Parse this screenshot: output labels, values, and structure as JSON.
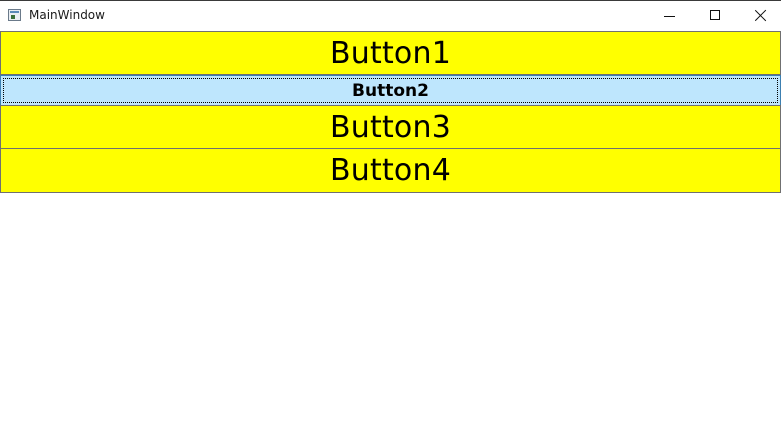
{
  "window": {
    "title": "MainWindow",
    "icon": "app-window-icon",
    "controls": {
      "minimize": "minimize-icon",
      "maximize": "maximize-icon",
      "close": "close-icon"
    }
  },
  "buttons": [
    {
      "label": "Button1",
      "background": "#ffff00",
      "state": "normal"
    },
    {
      "label": "Button2",
      "background": "#bee6fd",
      "state": "hover-focused"
    },
    {
      "label": "Button3",
      "background": "#ffff00",
      "state": "normal"
    },
    {
      "label": "Button4",
      "background": "#ffff00",
      "state": "normal"
    }
  ]
}
